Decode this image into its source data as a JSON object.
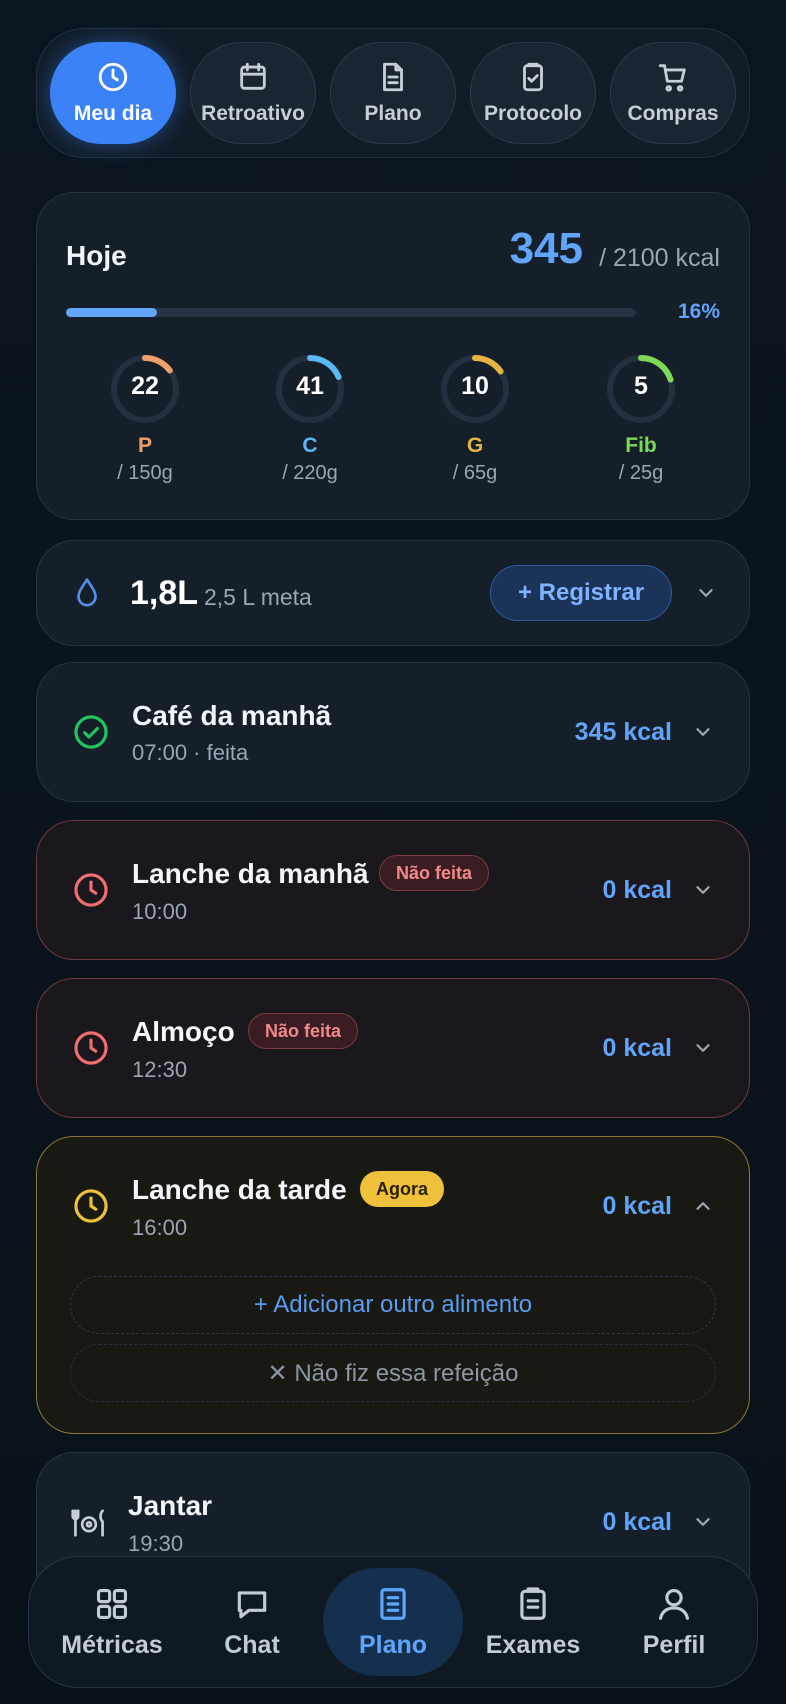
{
  "top_tabs": [
    {
      "label": "Meu dia",
      "icon": "clock-icon",
      "active": true
    },
    {
      "label": "Retroativo",
      "icon": "calendar-icon",
      "active": false
    },
    {
      "label": "Plano",
      "icon": "document-icon",
      "active": false
    },
    {
      "label": "Protocolo",
      "icon": "clipboard-check-icon",
      "active": false
    },
    {
      "label": "Compras",
      "icon": "cart-icon",
      "active": false
    }
  ],
  "summary": {
    "title": "Hoje",
    "kcal_consumed": "345",
    "kcal_goal": "/ 2100 kcal",
    "progress_pct": "16%",
    "progress_fraction": 0.16,
    "macros": [
      {
        "value": "22",
        "letter": "P",
        "goal": "/ 150g",
        "color": "#f2a06b",
        "fraction": 0.147
      },
      {
        "value": "41",
        "letter": "C",
        "goal": "/ 220g",
        "color": "#5ab8f5",
        "fraction": 0.186
      },
      {
        "value": "10",
        "letter": "G",
        "goal": "/ 65g",
        "color": "#e8b440",
        "fraction": 0.154
      },
      {
        "value": "5",
        "letter": "Fib",
        "goal": "/ 25g",
        "color": "#7ed957",
        "fraction": 0.2
      }
    ]
  },
  "water": {
    "icon": "droplet-icon",
    "value": "1,8L",
    "goal": "2,5 L meta",
    "register_label": "+ Registrar"
  },
  "meals": [
    {
      "name": "Café da manhã",
      "subtitle": "07:00 · feita",
      "kcal": "345 kcal",
      "status": "done",
      "badge": ""
    },
    {
      "name": "Lanche da manhã",
      "subtitle": "10:00",
      "kcal": "0 kcal",
      "status": "missed",
      "badge": "Não feita"
    },
    {
      "name": "Almoço",
      "subtitle": "12:30",
      "kcal": "0 kcal",
      "status": "missed",
      "badge": "Não feita"
    },
    {
      "name": "Lanche da tarde",
      "subtitle": "16:00",
      "kcal": "0 kcal",
      "status": "now",
      "badge": "Agora",
      "add_food_label": "+ Adicionar outro alimento",
      "skip_label": "✕ Não fiz essa refeição"
    },
    {
      "name": "Jantar",
      "subtitle": "19:30",
      "kcal": "0 kcal",
      "status": "upcoming",
      "badge": ""
    }
  ],
  "bottom_nav": [
    {
      "label": "Métricas",
      "icon": "grid-icon",
      "active": false
    },
    {
      "label": "Chat",
      "icon": "chat-icon",
      "active": false
    },
    {
      "label": "Plano",
      "icon": "document-icon",
      "active": true
    },
    {
      "label": "Exames",
      "icon": "clipboard-icon",
      "active": false
    },
    {
      "label": "Perfil",
      "icon": "user-icon",
      "active": false
    }
  ],
  "colors": {
    "accent": "#3b82f6",
    "kcal_blue": "#60a5fa",
    "done_green": "#22c55e",
    "missed_red": "#f07070",
    "now_yellow": "#f0c23b"
  }
}
